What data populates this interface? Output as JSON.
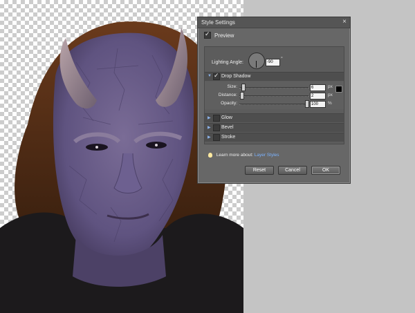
{
  "dialog": {
    "title": "Style Settings",
    "close_symbol": "×",
    "preview_label": "Preview",
    "preview_checked": true,
    "lighting_angle_label": "Lighting Angle:",
    "lighting_angle_value": "-90",
    "lighting_angle_unit": "°",
    "drop_shadow": {
      "label": "Drop Shadow",
      "checked": true,
      "size": {
        "label": "Size:",
        "value": "6",
        "unit": "px"
      },
      "distance": {
        "label": "Distance:",
        "value": "2",
        "unit": "px"
      },
      "opacity": {
        "label": "Opacity:",
        "value": "100",
        "unit": "%"
      },
      "color": "#000000"
    },
    "sections": [
      {
        "label": "Glow",
        "checked": false
      },
      {
        "label": "Bevel",
        "checked": false
      },
      {
        "label": "Stroke",
        "checked": false
      }
    ],
    "learn_more_prefix": "Learn more about:",
    "learn_more_link": "Layer Styles",
    "buttons": {
      "reset": "Reset",
      "cancel": "Cancel",
      "ok": "OK"
    }
  },
  "icons": {
    "close": "close-icon",
    "expand": "chevron-right-icon",
    "collapse": "chevron-down-icon",
    "tip": "lightbulb-icon"
  },
  "colors": {
    "dialog_bg": "#676767",
    "link": "#7cb3ff",
    "skin": "#6b5d86"
  }
}
